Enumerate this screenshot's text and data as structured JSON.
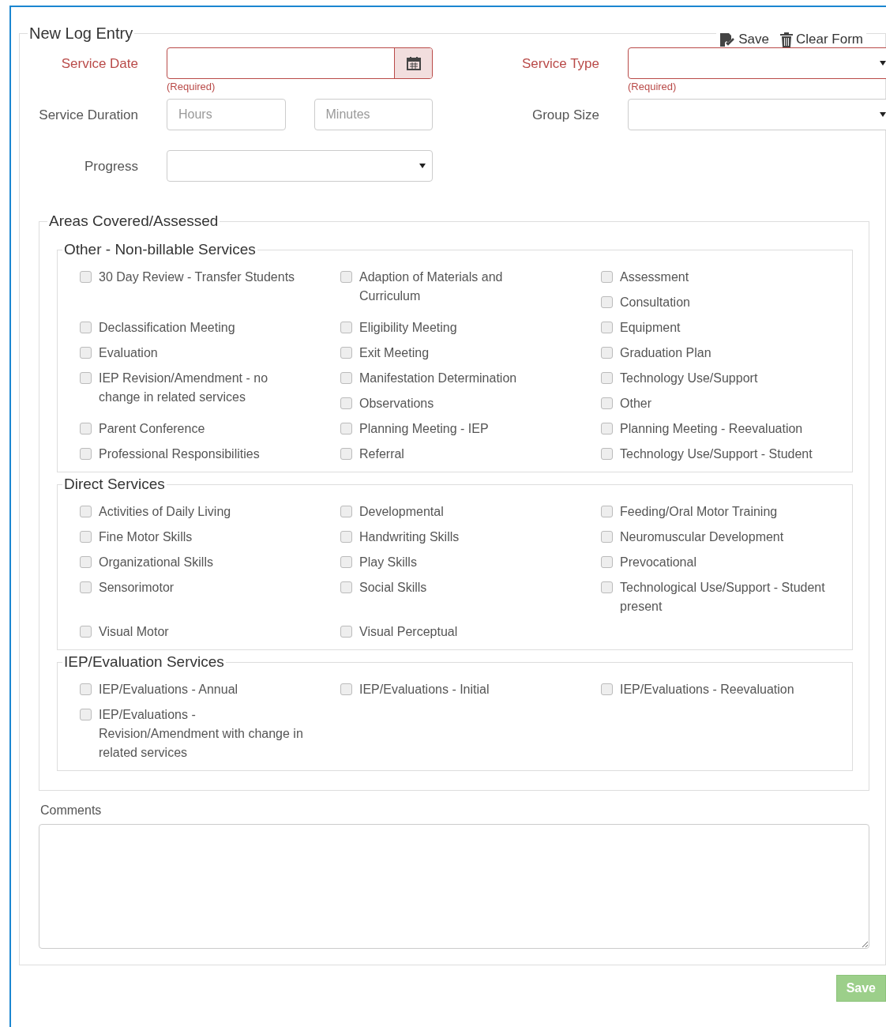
{
  "form": {
    "title": "New Log Entry",
    "actions": [
      {
        "kind": "save",
        "label": "Save"
      },
      {
        "kind": "clear",
        "label": "Clear Form"
      }
    ]
  },
  "fields": {
    "service_date": {
      "label": "Service Date",
      "required": true,
      "note": "(Required)"
    },
    "service_type": {
      "label": "Service Type",
      "required": true,
      "note": "(Required)"
    },
    "service_duration": {
      "label": "Service Duration",
      "hours_placeholder": "Hours",
      "minutes_placeholder": "Minutes"
    },
    "group_size": {
      "label": "Group Size"
    },
    "progress": {
      "label": "Progress"
    }
  },
  "areas": {
    "title": "Areas Covered/Assessed",
    "groups": [
      {
        "title": "Other - Non-billable Services",
        "rows": [
          [
            [
              {
                "label": "30 Day Review - Transfer Students",
                "checked": false
              }
            ],
            [
              {
                "label": "Adaption of Materials and Curriculum",
                "checked": false
              }
            ],
            [
              {
                "label": "Assessment",
                "checked": false
              },
              {
                "label": "Consultation",
                "checked": false
              }
            ]
          ],
          [
            [
              {
                "label": "Declassification Meeting",
                "checked": false
              }
            ],
            [
              {
                "label": "Eligibility Meeting",
                "checked": false
              }
            ],
            [
              {
                "label": "Equipment",
                "checked": false
              }
            ]
          ],
          [
            [
              {
                "label": "Evaluation",
                "checked": false
              }
            ],
            [
              {
                "label": "Exit Meeting",
                "checked": false
              }
            ],
            [
              {
                "label": "Graduation Plan",
                "checked": false
              }
            ]
          ],
          [
            [
              {
                "label": "IEP Revision/Amendment - no change in related services",
                "checked": false
              }
            ],
            [
              {
                "label": "Manifestation Determination",
                "checked": false
              },
              {
                "label": "Observations",
                "checked": false
              }
            ],
            [
              {
                "label": "Technology Use/Support",
                "checked": false
              },
              {
                "label": "Other",
                "checked": false
              }
            ]
          ],
          [
            [
              {
                "label": "Parent Conference",
                "checked": false
              }
            ],
            [
              {
                "label": "Planning Meeting - IEP",
                "checked": false
              }
            ],
            [
              {
                "label": "Planning Meeting - Reevaluation",
                "checked": false
              }
            ]
          ],
          [
            [
              {
                "label": "Professional Responsibilities",
                "checked": false
              }
            ],
            [
              {
                "label": "Referral",
                "checked": false
              }
            ],
            [
              {
                "label": "Technology Use/Support - Student",
                "checked": false
              }
            ]
          ]
        ]
      },
      {
        "title": "Direct Services",
        "rows": [
          [
            [
              {
                "label": "Activities of Daily Living",
                "checked": false
              }
            ],
            [
              {
                "label": "Developmental",
                "checked": false
              }
            ],
            [
              {
                "label": "Feeding/Oral Motor Training",
                "checked": false
              }
            ]
          ],
          [
            [
              {
                "label": "Fine Motor Skills",
                "checked": false
              }
            ],
            [
              {
                "label": "Handwriting Skills",
                "checked": false
              }
            ],
            [
              {
                "label": "Neuromuscular Development",
                "checked": false
              }
            ]
          ],
          [
            [
              {
                "label": "Organizational Skills",
                "checked": false
              }
            ],
            [
              {
                "label": "Play Skills",
                "checked": false
              }
            ],
            [
              {
                "label": "Prevocational",
                "checked": false
              }
            ]
          ],
          [
            [
              {
                "label": "Sensorimotor",
                "checked": false
              }
            ],
            [
              {
                "label": "Social Skills",
                "checked": false
              }
            ],
            [
              {
                "label": "Technological Use/Support - Student present",
                "checked": false
              }
            ]
          ],
          [
            [
              {
                "label": "Visual Motor",
                "checked": false
              }
            ],
            [
              {
                "label": "Visual Perceptual",
                "checked": false
              }
            ],
            []
          ]
        ]
      },
      {
        "title": "IEP/Evaluation Services",
        "rows": [
          [
            [
              {
                "label": "IEP/Evaluations - Annual",
                "checked": false
              },
              {
                "label": "IEP/Evaluations - Revision/Amendment with change in related services",
                "checked": false
              }
            ],
            [
              {
                "label": "IEP/Evaluations - Initial",
                "checked": false
              }
            ],
            [
              {
                "label": "IEP/Evaluations - Reevaluation",
                "checked": false
              }
            ]
          ]
        ]
      }
    ]
  },
  "comments": {
    "label": "Comments"
  },
  "submit": {
    "label": "Save",
    "disabled": true
  }
}
